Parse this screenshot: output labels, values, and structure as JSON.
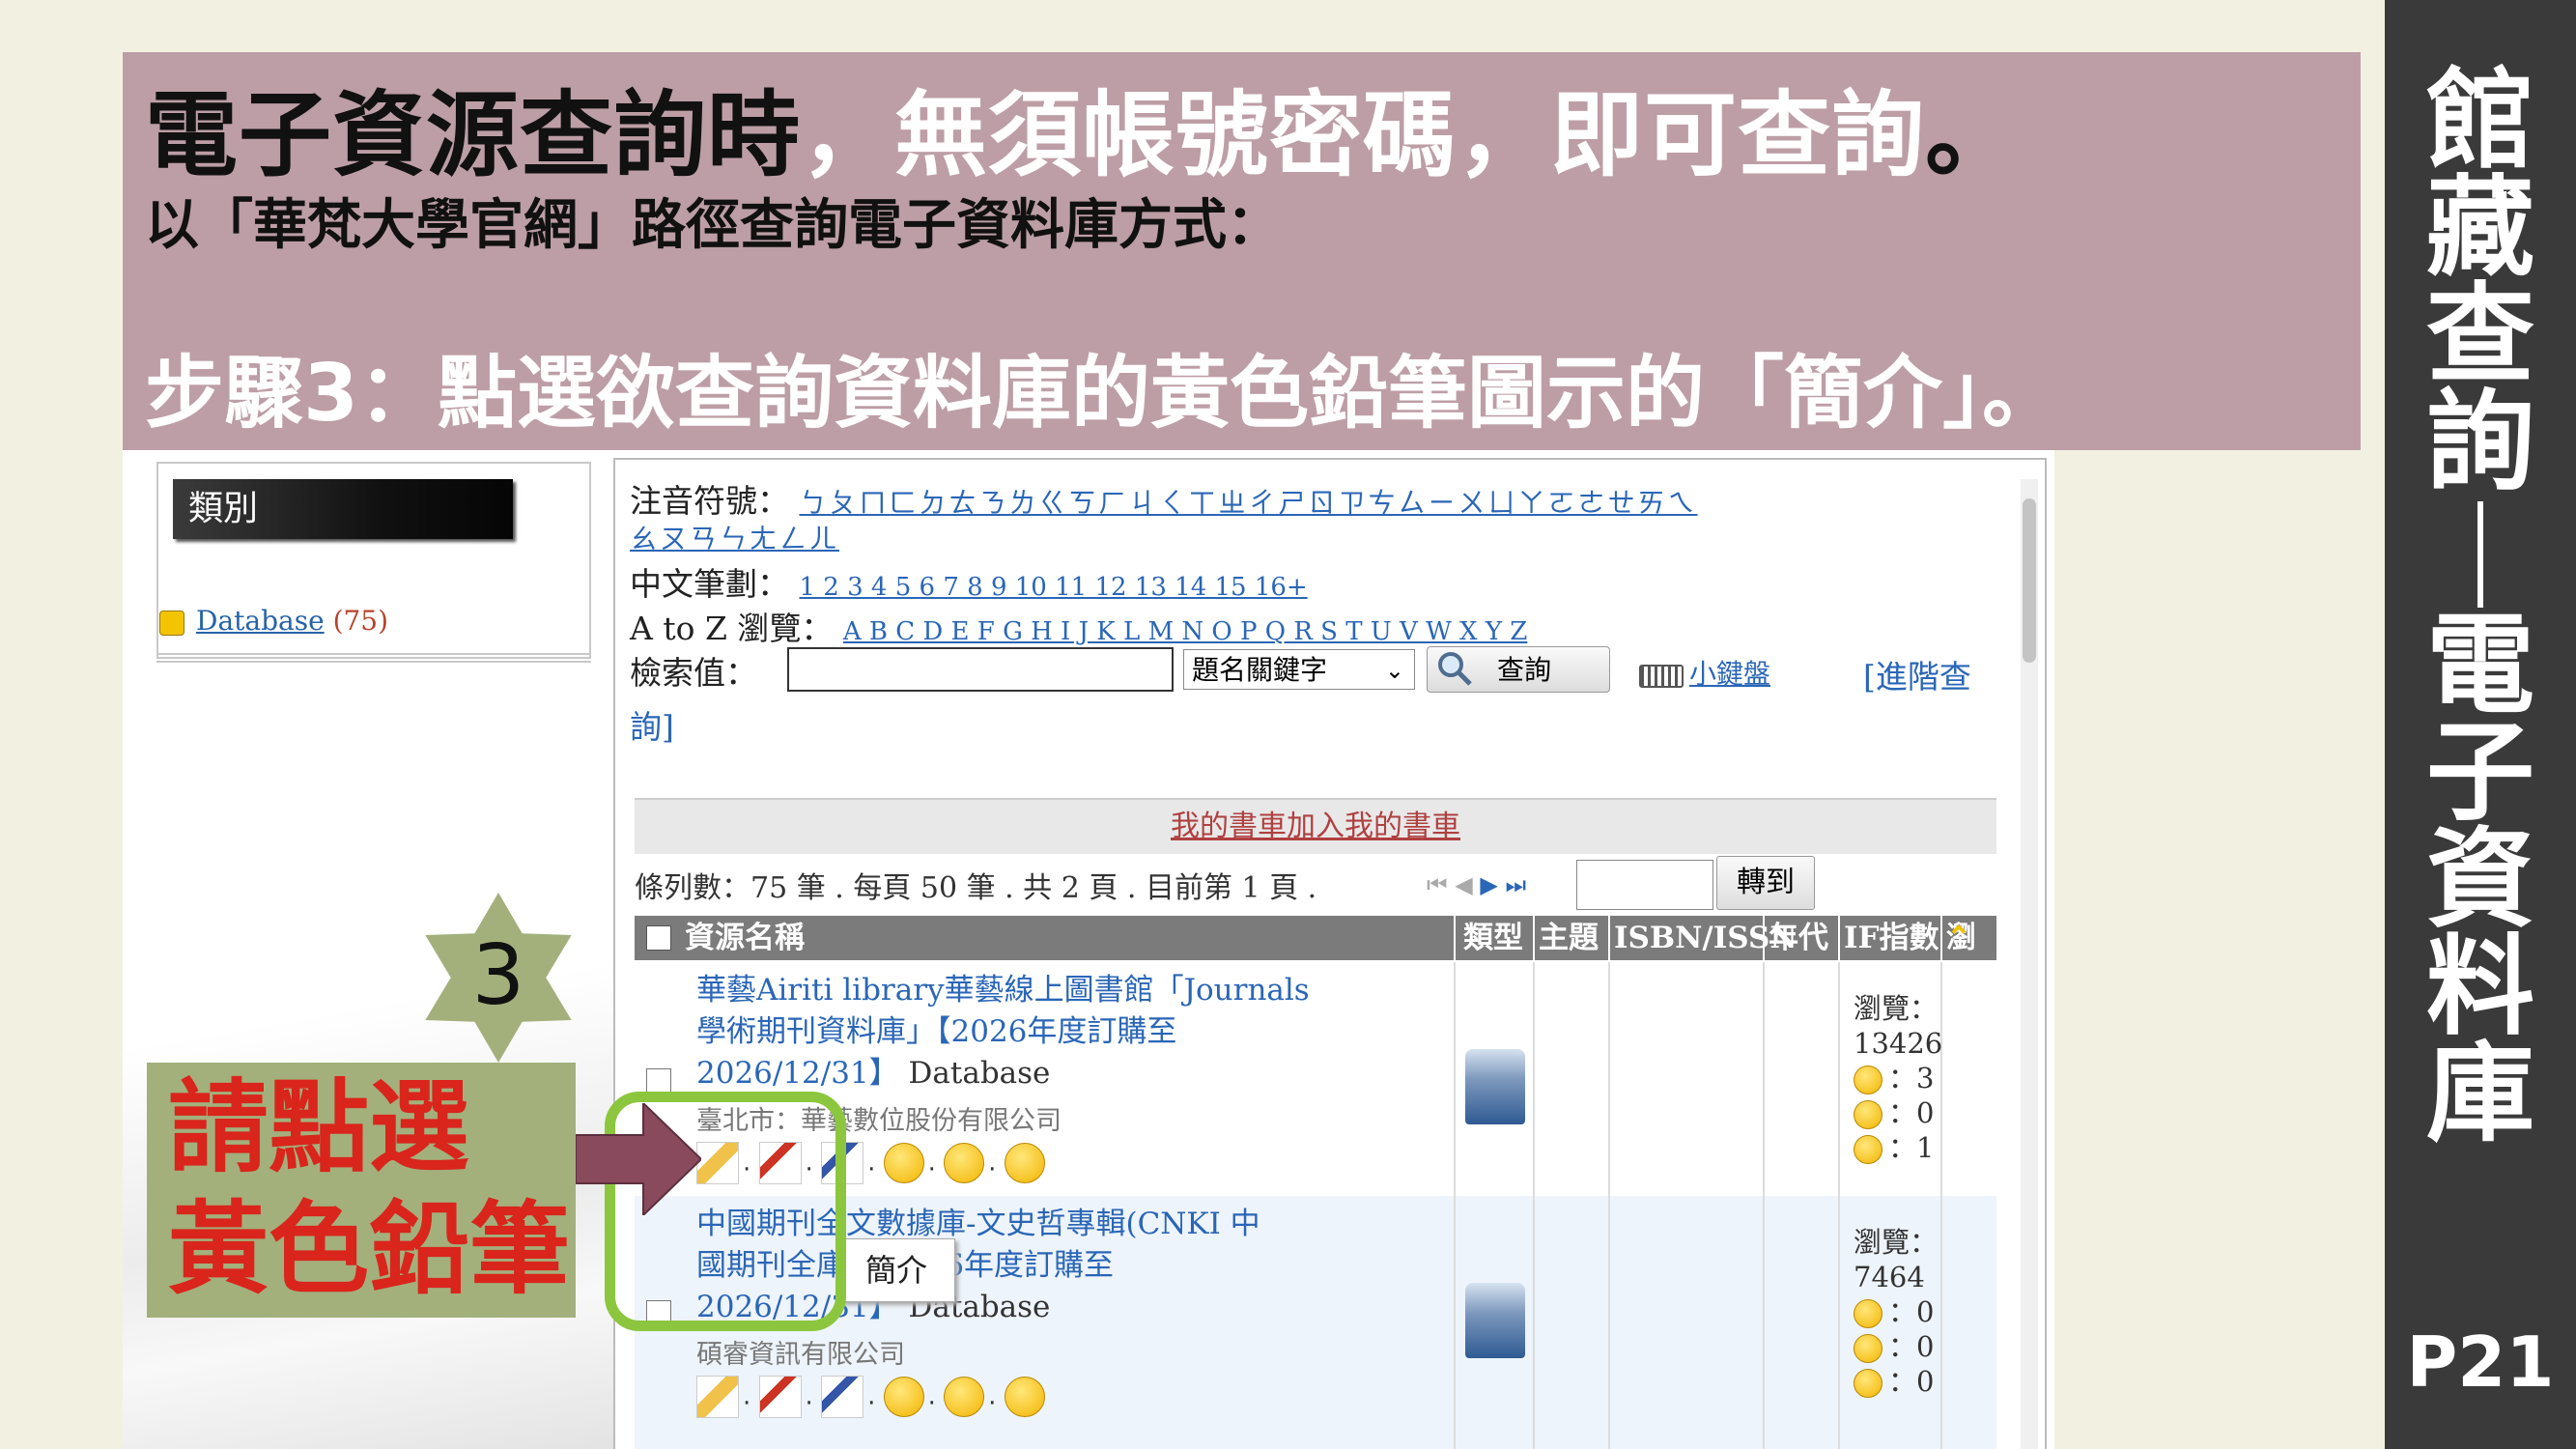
{
  "slide": {
    "title_dark_1": "電子資源查詢時",
    "title_white": "，無須帳號密碼，",
    "title_dark_2": "即可查詢",
    "title_dark_3": "。",
    "subtitle": "以「華梵大學官網」路徑查詢電子資料庫方式：",
    "step": "步驟3：點選欲查詢資料庫的黃色鉛筆圖示的「簡介」。",
    "side_title_top": [
      "館",
      "藏",
      "查",
      "詢"
    ],
    "side_title_bottom": [
      "電",
      "子",
      "資",
      "料",
      "庫"
    ],
    "page_number": "P21",
    "step_badge": "3",
    "callout_line1": "請點選",
    "callout_line2": "黃色鉛筆",
    "colors": {
      "banner": "#bd9ea6",
      "sidebar": "#3a3a3a",
      "callout": "#a3b07c",
      "callout_text": "#d9251c",
      "highlight": "#8cc63f",
      "arrow": "#8a4a5e"
    }
  },
  "screen": {
    "category": {
      "header": "類別",
      "item_label": "Database",
      "item_count": "(75)"
    },
    "zhuyin": {
      "label": "注音符號：",
      "line1": "ㄅㄆㄇㄈㄉㄊㄋㄌㄍㄎㄏㄐㄑㄒㄓㄔㄕㄖㄗㄘㄙㄧㄨㄩㄚㄛㄜㄝㄞㄟ",
      "line2": "ㄠㄡㄢㄣㄤㄥㄦ"
    },
    "strokes": {
      "label": "中文筆劃：",
      "values": "1 2 3 4 5 6 7 8 9 10 11 12 13 14 15 16+"
    },
    "az": {
      "label": "A to Z 瀏覽：",
      "values": "A B C D E F G H I J K L M N O P Q R S T U V W X Y Z"
    },
    "search": {
      "label": "檢索值：",
      "input_value": "",
      "select_value": "題名關鍵字",
      "button": "查詢",
      "keyboard": "小鍵盤",
      "advanced_1": "[進階查",
      "advanced_2": "詢]"
    },
    "cart": "我的書車加入我的書車",
    "count_text": "條列數：75 筆 . 每頁 50 筆 . 共 2 頁 . 目前第 1 頁 .",
    "pager": {
      "first": "⏮",
      "prev": "◀",
      "next": "▶",
      "last": "⏭",
      "goto_button": "轉到"
    },
    "columns": [
      "資源名稱",
      "類型",
      "主題",
      "ISBN/ISSN",
      "年代",
      "IF指數",
      "瀏覽"
    ],
    "sort_arrow": "⌃",
    "results": [
      {
        "title_lines": [
          "華藝Airiti library華藝線上圖書館「Journals",
          "學術期刊資料庫」【2026年度訂購至",
          "2026/12/31】"
        ],
        "type": "Database",
        "publisher": "臺北市：華藝數位股份有限公司",
        "views_label": "瀏覽：",
        "views": "13426",
        "r1": "：3",
        "r2": "：0",
        "r3": "：1"
      },
      {
        "title_lines": [
          "中國期刊全文數據庫-文史哲專輯(CNKI 中",
          "國期刊全庫)【2026年度訂購至",
          "2026/12/31】"
        ],
        "type": "Database",
        "publisher": "碩睿資訊有限公司",
        "views_label": "瀏覽：",
        "views": "7464",
        "r1": "：0",
        "r2": "：0",
        "r3": "：0"
      }
    ],
    "tooltip": "簡介",
    "icon_names": [
      "pencil-icon",
      "cmarc-icon",
      "marc21-icon",
      "smile-icon",
      "neutral-icon",
      "sad-icon",
      "database-icon"
    ]
  }
}
